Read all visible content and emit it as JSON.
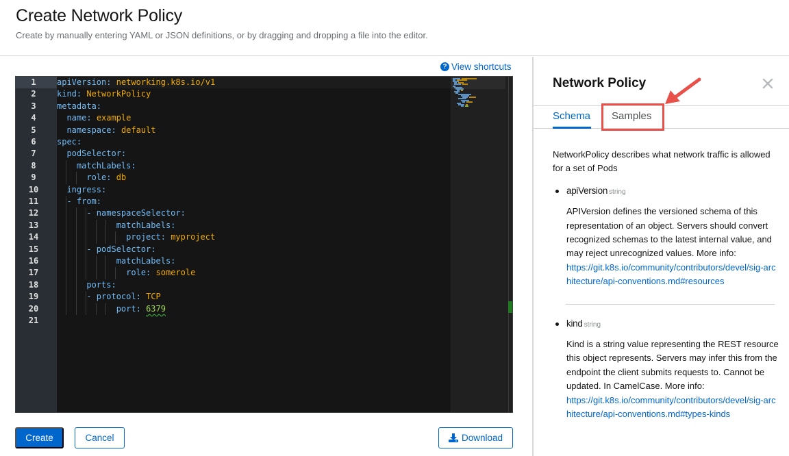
{
  "page": {
    "title": "Create Network Policy",
    "subtitle": "Create by manually entering YAML or JSON definitions, or by dragging and dropping a file into the editor."
  },
  "editor": {
    "shortcuts_label": "View shortcuts",
    "shortcuts_icon": "question-circle-icon",
    "active_line": 1,
    "lines": [
      {
        "n": "1",
        "indent": 0,
        "dash": false,
        "key": "apiVersion",
        "value": "networking.k8s.io/v1",
        "vtype": "str"
      },
      {
        "n": "2",
        "indent": 0,
        "dash": false,
        "key": "kind",
        "value": "NetworkPolicy",
        "vtype": "str"
      },
      {
        "n": "3",
        "indent": 0,
        "dash": false,
        "key": "metadata",
        "value": "",
        "vtype": ""
      },
      {
        "n": "4",
        "indent": 1,
        "dash": false,
        "key": "name",
        "value": "example",
        "vtype": "str"
      },
      {
        "n": "5",
        "indent": 1,
        "dash": false,
        "key": "namespace",
        "value": "default",
        "vtype": "str"
      },
      {
        "n": "6",
        "indent": 0,
        "dash": false,
        "key": "spec",
        "value": "",
        "vtype": ""
      },
      {
        "n": "7",
        "indent": 1,
        "dash": false,
        "key": "podSelector",
        "value": "",
        "vtype": ""
      },
      {
        "n": "8",
        "indent": 2,
        "dash": false,
        "key": "matchLabels",
        "value": "",
        "vtype": ""
      },
      {
        "n": "9",
        "indent": 3,
        "dash": false,
        "key": "role",
        "value": "db",
        "vtype": "str"
      },
      {
        "n": "10",
        "indent": 1,
        "dash": false,
        "key": "ingress",
        "value": "",
        "vtype": ""
      },
      {
        "n": "11",
        "indent": 2,
        "dash": true,
        "key": "from",
        "value": "",
        "vtype": ""
      },
      {
        "n": "12",
        "indent": 4,
        "dash": true,
        "key": "namespaceSelector",
        "value": "",
        "vtype": ""
      },
      {
        "n": "13",
        "indent": 6,
        "dash": false,
        "key": "matchLabels",
        "value": "",
        "vtype": ""
      },
      {
        "n": "14",
        "indent": 7,
        "dash": false,
        "key": "project",
        "value": "myproject",
        "vtype": "str"
      },
      {
        "n": "15",
        "indent": 4,
        "dash": true,
        "key": "podSelector",
        "value": "",
        "vtype": ""
      },
      {
        "n": "16",
        "indent": 6,
        "dash": false,
        "key": "matchLabels",
        "value": "",
        "vtype": ""
      },
      {
        "n": "17",
        "indent": 7,
        "dash": false,
        "key": "role",
        "value": "somerole",
        "vtype": "str"
      },
      {
        "n": "18",
        "indent": 3,
        "dash": false,
        "key": "ports",
        "value": "",
        "vtype": ""
      },
      {
        "n": "19",
        "indent": 4,
        "dash": true,
        "key": "protocol",
        "value": "TCP",
        "vtype": "str"
      },
      {
        "n": "20",
        "indent": 6,
        "dash": false,
        "key": "port",
        "value": "6379",
        "vtype": "num"
      },
      {
        "n": "21",
        "indent": 0,
        "dash": false,
        "key": "",
        "value": "",
        "vtype": ""
      }
    ]
  },
  "actions": {
    "create_label": "Create",
    "cancel_label": "Cancel",
    "download_label": "Download",
    "download_icon": "download-icon"
  },
  "sidebar": {
    "title": "Network Policy",
    "close_icon": "close-icon",
    "tabs": [
      {
        "label": "Schema",
        "active": true
      },
      {
        "label": "Samples",
        "active": false,
        "highlighted": true
      }
    ],
    "description": "NetworkPolicy describes what network traffic is allowed for a set of Pods",
    "fields": [
      {
        "name": "apiVersion",
        "type": "string",
        "description": "APIVersion defines the versioned schema of this representation of an object. Servers should convert recognized schemas to the latest internal value, and may reject unrecognized values. More info:",
        "link": "https://git.k8s.io/community/contributors/devel/sig-architecture/api-conventions.md#resources"
      },
      {
        "name": "kind",
        "type": "string",
        "description": "Kind is a string value representing the REST resource this object represents. Servers may infer this from the endpoint the client submits requests to. Cannot be updated. In CamelCase. More info:",
        "link": "https://git.k8s.io/community/contributors/devel/sig-architecture/api-conventions.md#types-kinds"
      }
    ]
  },
  "colors": {
    "accent": "#0066cc",
    "annotation": "#e8504a",
    "yaml_key": "#73bcf7",
    "yaml_string": "#f0ab00",
    "yaml_number": "#a2d85a"
  }
}
